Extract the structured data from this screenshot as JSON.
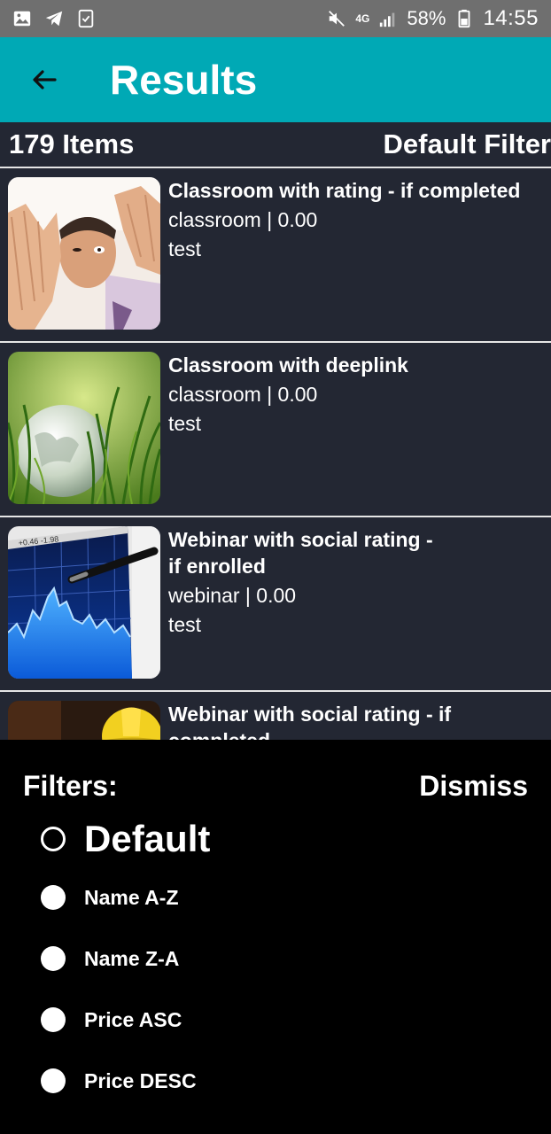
{
  "status_bar": {
    "network": "4G",
    "battery_percent": "58%",
    "time": "14:55"
  },
  "app_bar": {
    "title": "Results"
  },
  "summary": {
    "count_label": "179 Items",
    "filter_label": "Default Filter"
  },
  "items": [
    {
      "title": "Classroom with rating - if completed",
      "meta": "classroom | 0.00",
      "description": "test",
      "thumbnail": "man-framing-hands-photo"
    },
    {
      "title": "Classroom with deeplink",
      "meta": "classroom | 0.00",
      "description": "test",
      "thumbnail": "glass-globe-in-grass-photo"
    },
    {
      "title_line1": "Webinar with social rating -",
      "title_line2": "if enrolled",
      "meta": "webinar | 0.00",
      "description": "test",
      "thumbnail": "stock-chart-with-pen-photo"
    },
    {
      "title_line1": "Webinar with social rating - if",
      "title_line2": "completed",
      "thumbnail": "hard-hat-photo"
    }
  ],
  "filters_sheet": {
    "title": "Filters:",
    "dismiss_label": "Dismiss",
    "options": [
      {
        "label": "Default",
        "selected": true
      },
      {
        "label": "Name A-Z",
        "selected": false
      },
      {
        "label": "Name Z-A",
        "selected": false
      },
      {
        "label": "Price ASC",
        "selected": false
      },
      {
        "label": "Price DESC",
        "selected": false
      }
    ]
  },
  "colors": {
    "app_bar": "#00a9b5",
    "list_background": "#232733",
    "status_bar": "#6f6f6f",
    "sheet_background": "#000000"
  }
}
